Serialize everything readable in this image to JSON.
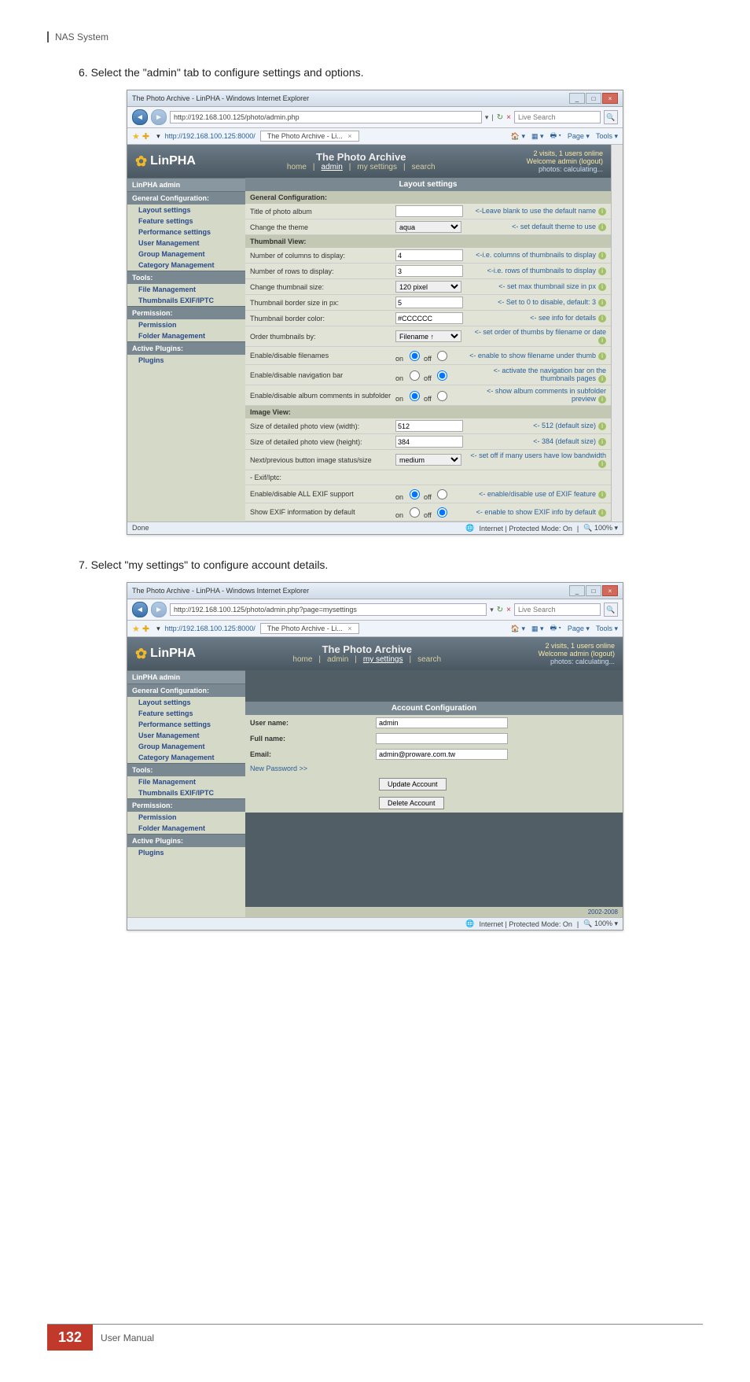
{
  "page": {
    "header": "NAS System",
    "step6": "6.  Select the \"admin\" tab to configure settings and options.",
    "step7": "7.  Select \"my settings\" to configure account details.",
    "footer_number": "132",
    "footer_label": "User Manual"
  },
  "ie": {
    "title": "The Photo Archive - LinPHA - Windows Internet Explorer",
    "url1": "http://192.168.100.125/photo/admin.php",
    "url2": "http://192.168.100.125/photo/admin.php?page=mysettings",
    "tab_addr": "http://192.168.100.125:8000/",
    "tab_title": "The Photo Archive - Li...",
    "search_placeholder": "Live Search",
    "toolbtns": {
      "page": "Page",
      "tools": "Tools"
    },
    "status_done": "Done",
    "status_blank": "",
    "zone": "Internet | Protected Mode: On",
    "zoom": "100%"
  },
  "app": {
    "logo": "LinPHA",
    "banner_title": "The Photo Archive",
    "nav": {
      "home": "home",
      "admin": "admin",
      "mysettings": "my settings",
      "search": "search"
    },
    "status_visits": "2 visits, 1 users online",
    "status_welcome": "Welcome admin (logout)",
    "status_photos": "photos: calculating..."
  },
  "sidebar": {
    "admin_title": "LinPHA admin",
    "s1": "General Configuration:",
    "items1": [
      "Layout settings",
      "Feature settings",
      "Performance settings",
      "User Management",
      "Group Management",
      "Category Management"
    ],
    "s2": "Tools:",
    "items2": [
      "File Management",
      "Thumbnails EXIF/IPTC"
    ],
    "s3": "Permission:",
    "items3": [
      "Permission",
      "Folder Management"
    ],
    "s4": "Active Plugins:",
    "items4": [
      "Plugins"
    ]
  },
  "layout": {
    "header": "Layout settings",
    "general_conf": "General Configuration:",
    "rows": {
      "title_label": "Title of photo album",
      "title_val": "",
      "title_hint": "<-Leave blank to use the default name",
      "theme_label": "Change the theme",
      "theme_val": "aqua",
      "theme_hint": "<- set default theme to use",
      "thumb_header": "Thumbnail View:",
      "cols_label": "Number of columns to display:",
      "cols_val": "4",
      "cols_hint": "<-i.e. columns of thumbnails to display",
      "rows_label": "Number of rows to display:",
      "rows_val": "3",
      "rows_hint": "<-i.e. rows of thumbnails to display",
      "thumbsize_label": "Change thumbnail size:",
      "thumbsize_val": "120 pixel",
      "thumbsize_hint": "<- set max thumbnail size in px",
      "border_label": "Thumbnail border size in px:",
      "border_val": "5",
      "border_hint": "<- Set to 0 to disable, default: 3",
      "bcolor_label": "Thumbnail border color:",
      "bcolor_val": "#CCCCCC",
      "bcolor_hint": "<- see info for details",
      "order_label": "Order thumbnails by:",
      "order_val": "Filename ↑",
      "order_hint": "<- set order of thumbs by filename or date",
      "fname_label": "Enable/disable filenames",
      "fname_hint": "<- enable to show filename under thumb",
      "navbar_label": "Enable/disable navigation bar",
      "navbar_hint": "<- activate the navigation bar on the thumbnails pages",
      "comments_label": "Enable/disable album comments in subfolder",
      "comments_hint": "<- show album comments in subfolder preview",
      "image_header": "Image View:",
      "width_label": "Size of detailed photo view (width):",
      "width_val": "512",
      "width_hint": "<- 512 (default size)",
      "height_label": "Size of detailed photo view (height):",
      "height_val": "384",
      "height_hint": "<- 384 (default size)",
      "nextprev_label": "Next/previous button image status/size",
      "nextprev_val": "medium",
      "nextprev_hint": "<- set off if many users have low bandwidth",
      "exifiptc_header": "- Exif/Iptc:",
      "exifsup_label": "Enable/disable ALL EXIF support",
      "exifsup_hint": "<- enable/disable use of EXIF feature",
      "exifdef_label": "Show EXIF information by default",
      "exifdef_hint": "<- enable to show EXIF info by default",
      "on": "on",
      "off": "off"
    }
  },
  "account": {
    "header": "Account Configuration",
    "user_label": "User name:",
    "user_val": "admin",
    "full_label": "Full name:",
    "full_val": "",
    "email_label": "Email:",
    "email_val": "admin@proware.com.tw",
    "newpw": "New Password >>",
    "update_btn": "Update Account",
    "delete_btn": "Delete Account",
    "footer_year": "2002-2008"
  }
}
